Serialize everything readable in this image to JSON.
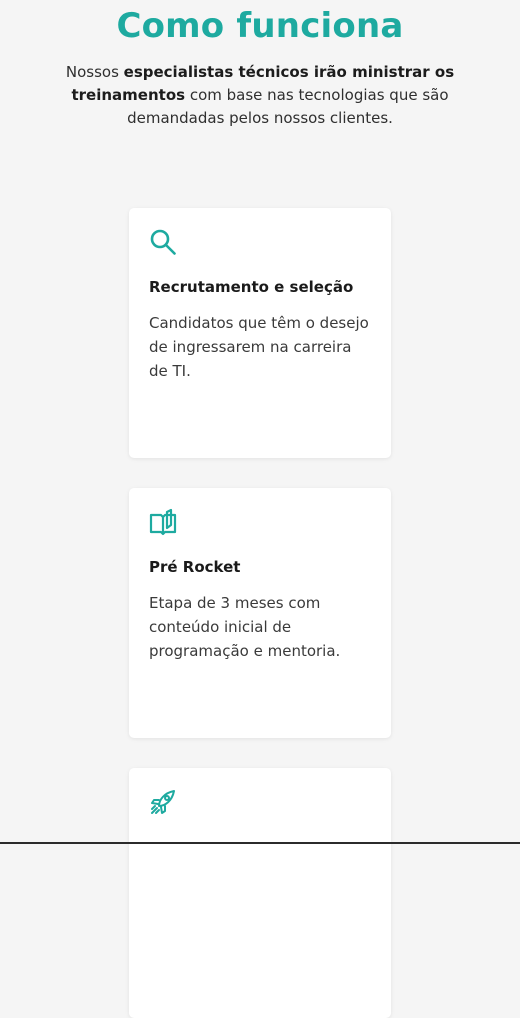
{
  "section": {
    "title": "Como funciona",
    "subtitle": {
      "part1": "Nossos ",
      "bold1": "especialistas técnicos irão ministrar os treinamentos",
      "part2": " com base nas tecnologias que são demandadas pelos nossos clientes."
    }
  },
  "cards": [
    {
      "icon": "search-icon",
      "title": "Recrutamento e seleção",
      "description": "Candidatos que têm o desejo de ingressarem na carreira de TI."
    },
    {
      "icon": "book-open-icon",
      "title": "Pré Rocket",
      "description": "Etapa de 3 meses com conteúdo inicial de programação e mentoria."
    },
    {
      "icon": "rocket-icon",
      "title": "",
      "description": ""
    }
  ],
  "colors": {
    "accent": "#1eaaa0",
    "background": "#f5f5f5",
    "card": "#ffffff"
  }
}
